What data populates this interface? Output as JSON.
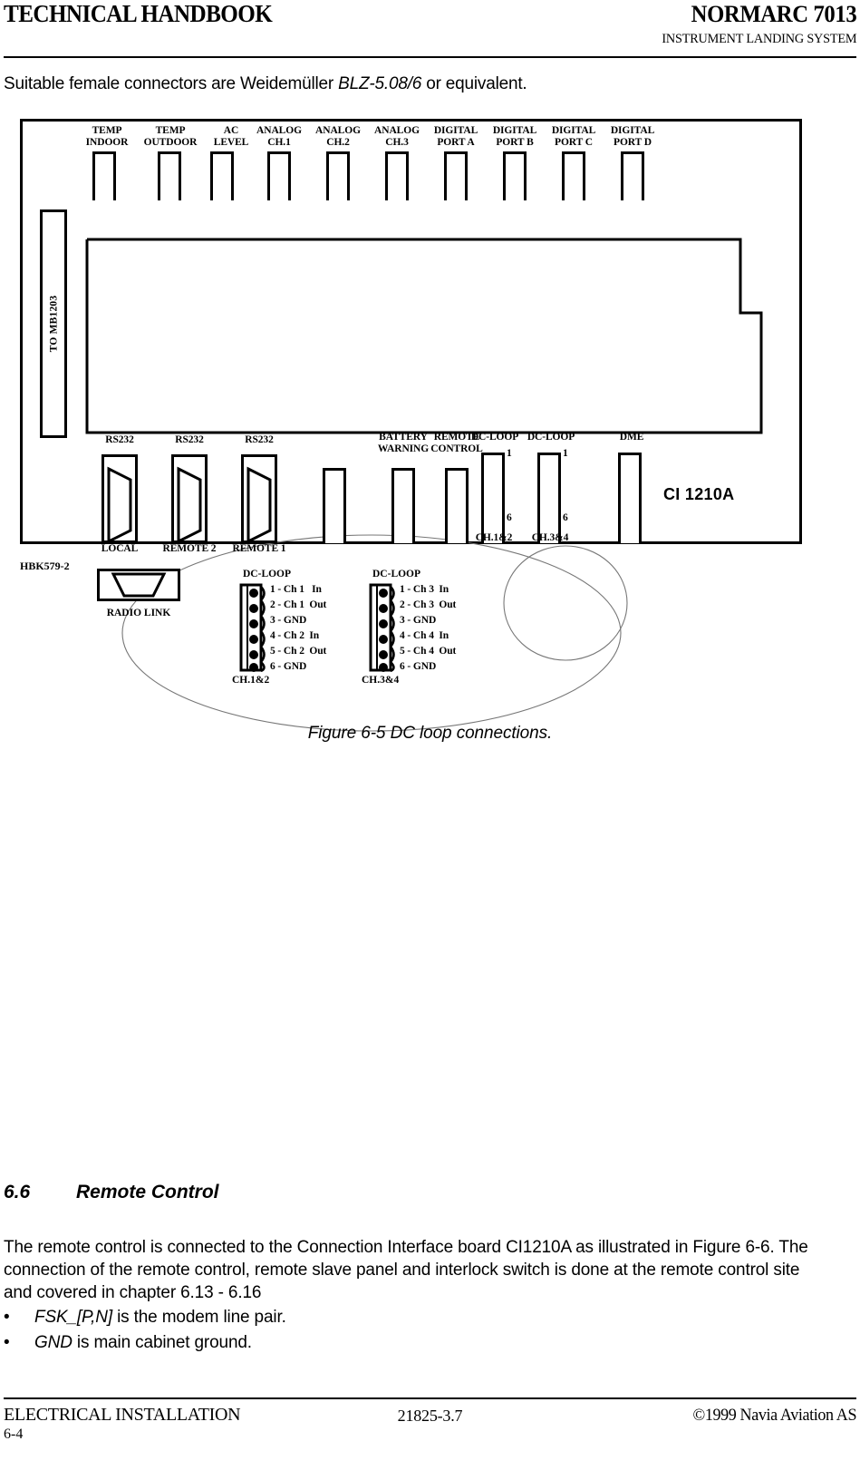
{
  "header": {
    "left": "TECHNICAL HANDBOOK",
    "right": "NORMARC 7013",
    "subtitle": "INSTRUMENT LANDING SYSTEM"
  },
  "intro": {
    "before": "Suitable female connectors are Weidemüller ",
    "emphasis": "BLZ-5.08/6",
    "after": " or equivalent."
  },
  "figure": {
    "board_title": "CI 1210A",
    "hbk_label": "HBK579-2",
    "radio_link_label": "RADIO LINK",
    "mb_connector_label": "TO MB1203",
    "top_connectors": [
      {
        "label": "TEMP\nINDOOR"
      },
      {
        "label": "TEMP\nOUTDOOR"
      },
      {
        "label": "AC\nLEVEL"
      },
      {
        "label": "ANALOG\nCH.1"
      },
      {
        "label": "ANALOG\nCH.2"
      },
      {
        "label": "ANALOG\nCH.3"
      },
      {
        "label": "DIGITAL\nPORT A"
      },
      {
        "label": "DIGITAL\nPORT B"
      },
      {
        "label": "DIGITAL\nPORT C"
      },
      {
        "label": "DIGITAL\nPORT D"
      }
    ],
    "bottom_connectors": [
      {
        "top_label": "RS232",
        "bottom_label": "LOCAL"
      },
      {
        "top_label": "RS232",
        "bottom_label": "REMOTE 2"
      },
      {
        "top_label": "RS232",
        "bottom_label": "REMOTE 1"
      },
      {
        "top_label": "",
        "bottom_label": ""
      },
      {
        "top_label": "BATTERY\nWARNING",
        "bottom_label": ""
      },
      {
        "top_label": "REMOTE\nCONTROL",
        "bottom_label": ""
      },
      {
        "top_label": "DC-LOOP",
        "bottom_label": "CH.1&2",
        "pin_first": "1",
        "pin_last": "6"
      },
      {
        "top_label": "DC-LOOP",
        "bottom_label": "CH.3&4",
        "pin_first": "1",
        "pin_last": "6"
      },
      {
        "top_label": "DME",
        "bottom_label": ""
      }
    ],
    "detail_left": {
      "title": "DC-LOOP",
      "footer": "CH.1&2",
      "pins": [
        "1 - Ch 1   In",
        "2 - Ch 1  Out",
        "3 - GND",
        "4 - Ch 2  In",
        "5 - Ch 2  Out",
        "6 - GND"
      ]
    },
    "detail_right": {
      "title": "DC-LOOP",
      "footer": "CH.3&4",
      "pins": [
        "1 - Ch 3  In",
        "2 - Ch 3  Out",
        "3 - GND",
        "4 - Ch 4  In",
        "5 - Ch 4  Out",
        "6 - GND"
      ]
    },
    "caption": "Figure 6-5 DC loop connections."
  },
  "section": {
    "number": "6.6",
    "title": "Remote Control",
    "paragraph": "The remote control is connected to the Connection Interface board CI1210A as illustrated in Figure 6-6. The connection of the remote control, remote slave panel and interlock switch is done at the remote control site and covered in chapter 6.13 - 6.16",
    "bullets": [
      {
        "marker": "•",
        "emphasis": "FSK_[P,N]",
        "rest": " is the modem line pair."
      },
      {
        "marker": "•",
        "emphasis": "GND",
        "rest": " is main cabinet ground."
      }
    ]
  },
  "footer": {
    "left": "ELECTRICAL INSTALLATION",
    "page": "6-4",
    "center": "21825-3.7",
    "right": "©1999 Navia Aviation AS"
  }
}
